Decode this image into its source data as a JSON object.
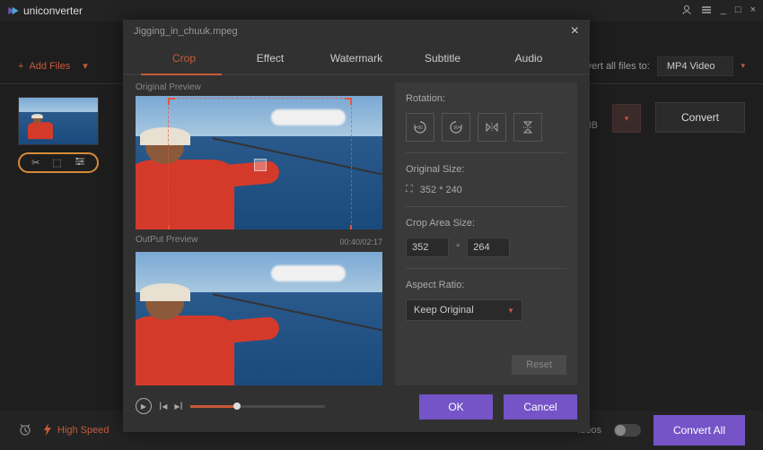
{
  "app": {
    "name": "uniconverter"
  },
  "titlebar": {
    "user_icon": "user",
    "menu_icon": "menu",
    "min_icon": "_",
    "max_icon": "□",
    "close_icon": "×"
  },
  "toolbar": {
    "add_files_label": "Add Files",
    "convert_to_label": "onvert all files to:",
    "format": "MP4 Video"
  },
  "file_item": {
    "size_label": "MB",
    "convert_label": "Convert"
  },
  "bottombar": {
    "high_speed_label": "High Speed",
    "videos_label": "ideos",
    "convert_all_label": "Convert All"
  },
  "modal": {
    "filename": "Jigging_in_chuuk.mpeg",
    "tabs": [
      "Crop",
      "Effect",
      "Watermark",
      "Subtitle",
      "Audio"
    ],
    "active_tab": 0,
    "original_preview_label": "Original Preview",
    "output_preview_label": "OutPut Preview",
    "time": "00:40/02:17",
    "rotation_label": "Rotation:",
    "original_size_label": "Original Size:",
    "original_size": "352 * 240",
    "crop_area_label": "Crop Area Size:",
    "crop_w": "352",
    "crop_h": "264",
    "aspect_label": "Aspect Ratio:",
    "aspect_value": "Keep Original",
    "reset_label": "Reset",
    "ok_label": "OK",
    "cancel_label": "Cancel"
  }
}
